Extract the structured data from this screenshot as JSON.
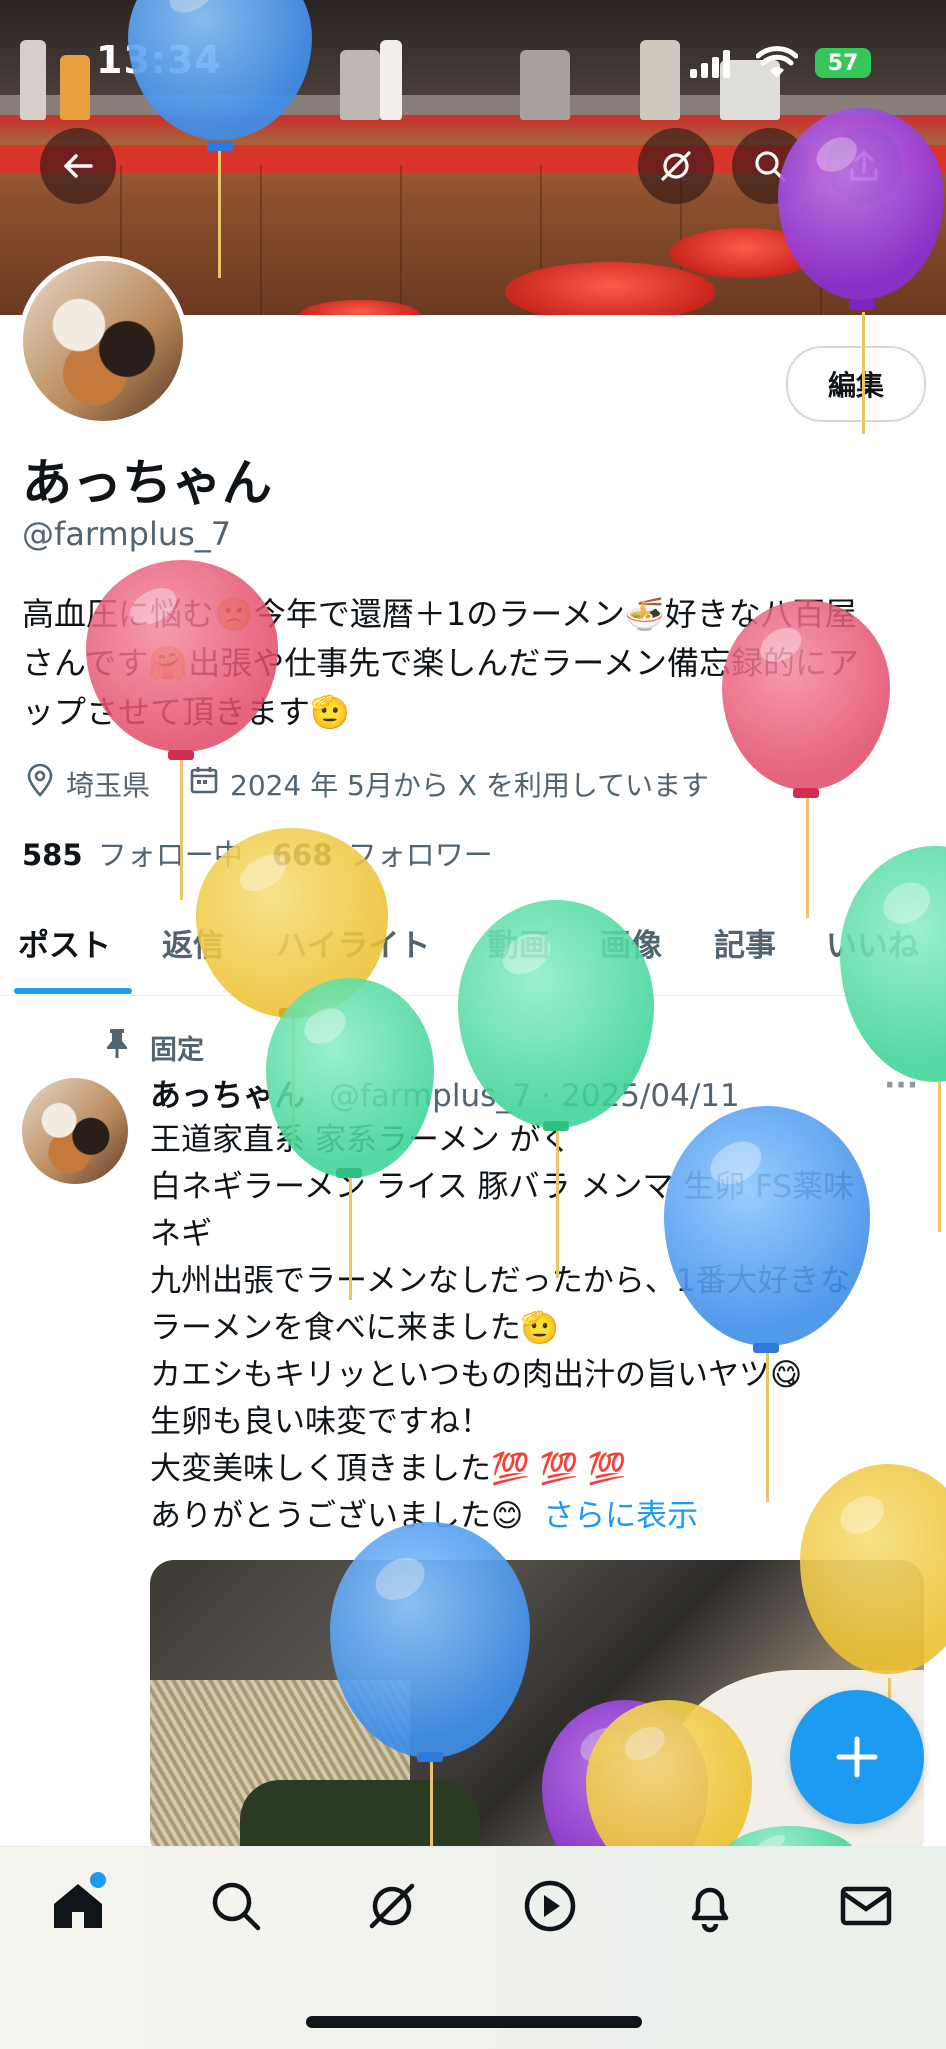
{
  "status_bar": {
    "time": "13:34",
    "battery": "57"
  },
  "profile": {
    "display_name": "あっちゃん",
    "handle": "@farmplus_7",
    "edit_label": "編集",
    "bio_lines": [
      "高血圧に悩む🙁今年で還暦＋1のラーメン🍜好きな八百屋",
      "さんです🤗出張や仕事先で楽しんだラーメン備忘録的にア",
      "ップさせて頂きます🫡"
    ],
    "location": "埼玉県",
    "joined": "2024 年 5月から X を利用しています",
    "following_count": "585",
    "following_label": "フォロー中",
    "followers_count": "668",
    "followers_label": "フォロワー"
  },
  "tabs": [
    "ポスト",
    "返信",
    "ハイライト",
    "動画",
    "画像",
    "記事",
    "いいね"
  ],
  "post": {
    "pinned_label": "固定",
    "author": "あっちゃん",
    "handle_date": "@farmplus_7 · 2025/04/11",
    "more": "···",
    "lines": [
      "王道家直系 家系ラーメン がく",
      "白ネギラーメン ライス 豚バラ メンマ 生卵 FS薬味",
      "ネギ",
      "九州出張でラーメンなしだったから、1番大好きな",
      "ラーメンを食べに来ました🫡",
      "カエシもキリッといつもの肉出汁の旨いヤツ😋",
      "生卵も良い味変ですね！",
      "大変美味しく頂きました💯 💯 💯",
      "ありがとうございました😊"
    ],
    "show_more": "さらに表示"
  },
  "colors": {
    "accent": "#1d9bf0",
    "text": "#0f1419",
    "muted": "#536471"
  }
}
